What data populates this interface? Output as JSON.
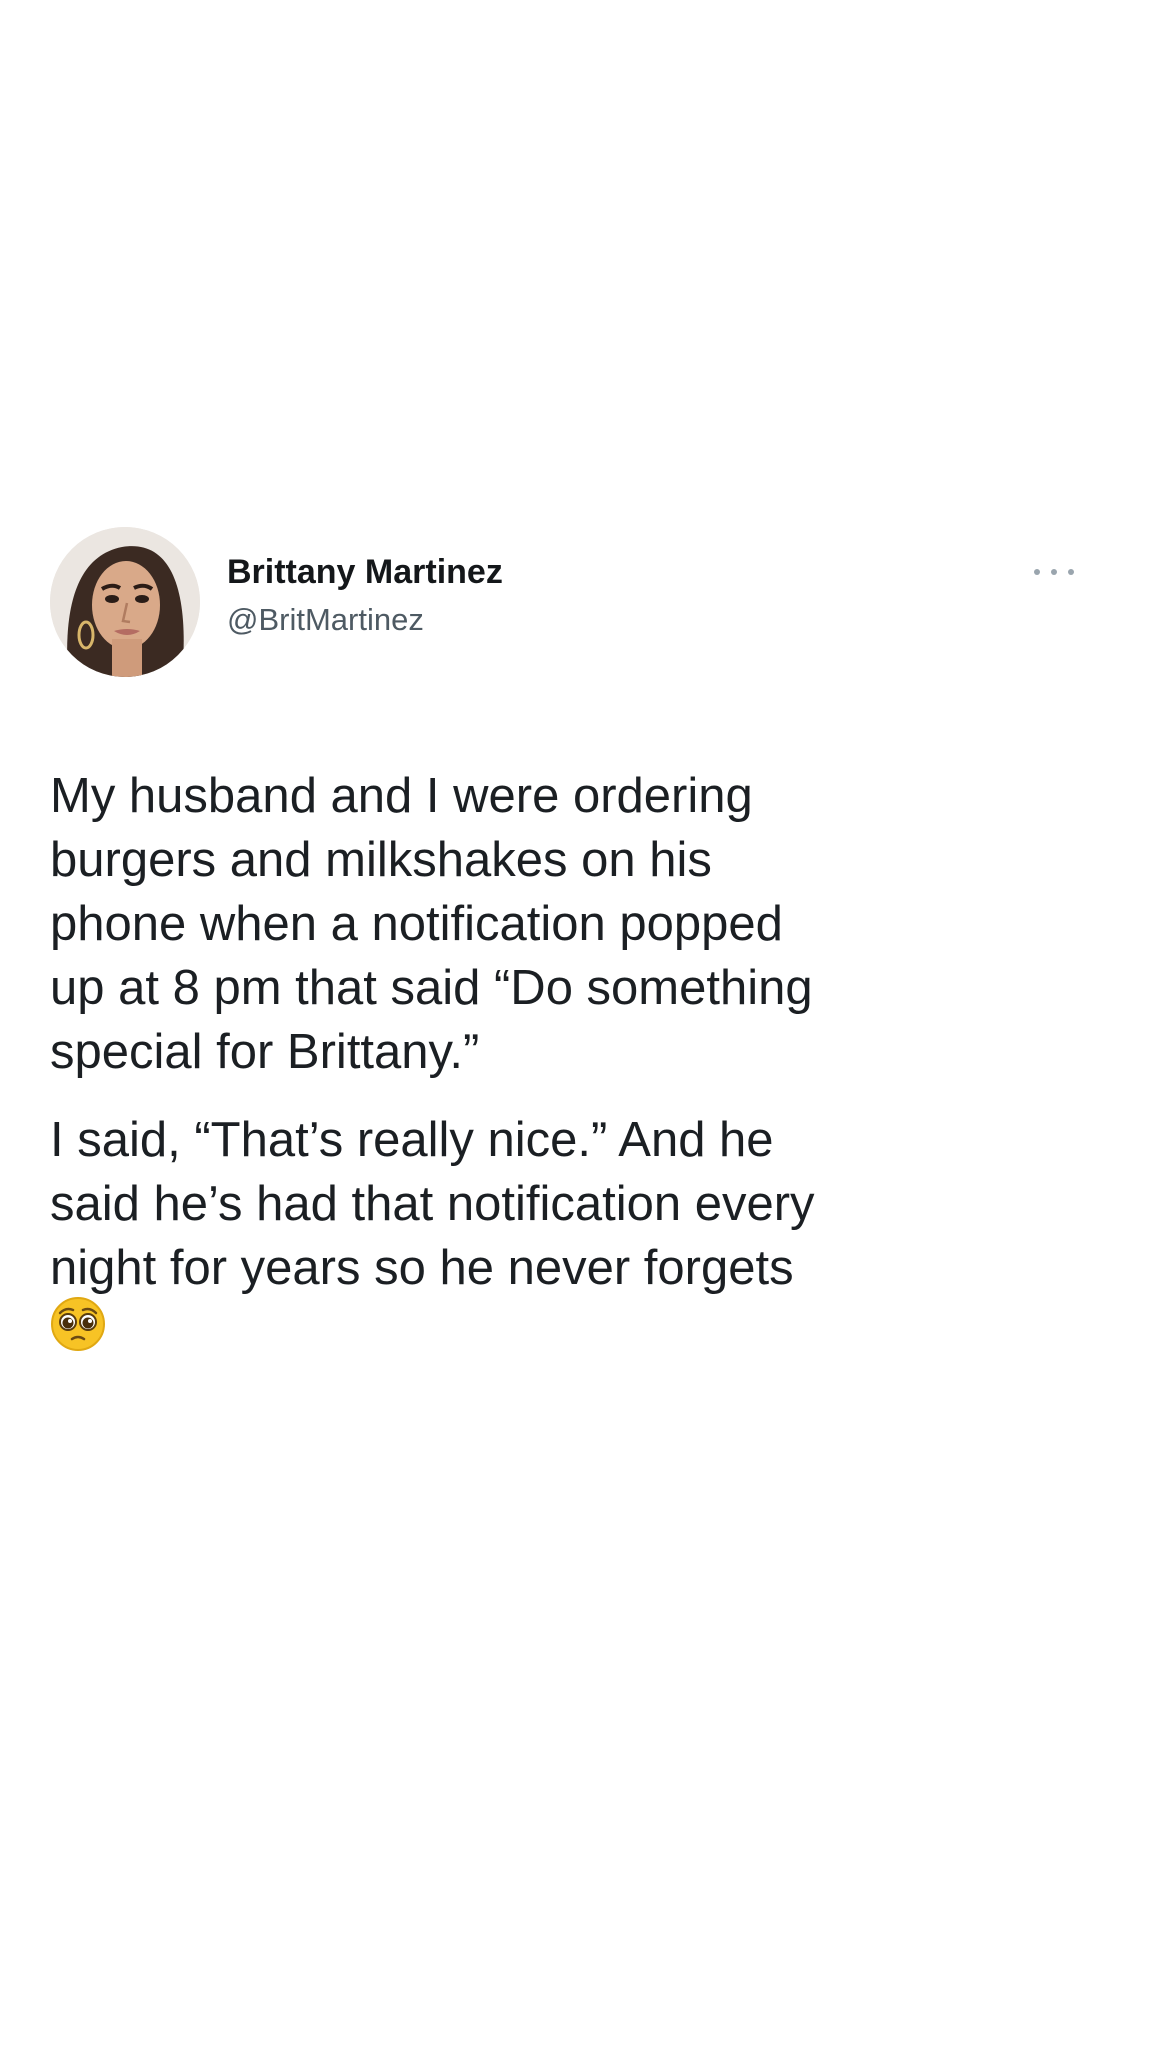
{
  "tweet": {
    "author": {
      "display_name": "Brittany Martinez",
      "handle": "@BritMartinez",
      "avatar_icon": "profile-photo"
    },
    "more_icon": "more-horizontal-icon",
    "paragraphs": [
      "My husband and I were ordering\nburgers and milkshakes on his\nphone when a notification popped\nup at 8 pm that said “Do something\nspecial for Brittany.”",
      "I said, “That’s really nice.” And he\nsaid he’s had that notification every\nnight for years so he never forgets"
    ],
    "emoji": "pleading-face-emoji"
  },
  "colors": {
    "background": "#ffffff",
    "text": "#1b1f23",
    "handle": "#4e5a63",
    "more_dots": "#9aa5ae",
    "emoji_yellow": "#f7c325"
  }
}
